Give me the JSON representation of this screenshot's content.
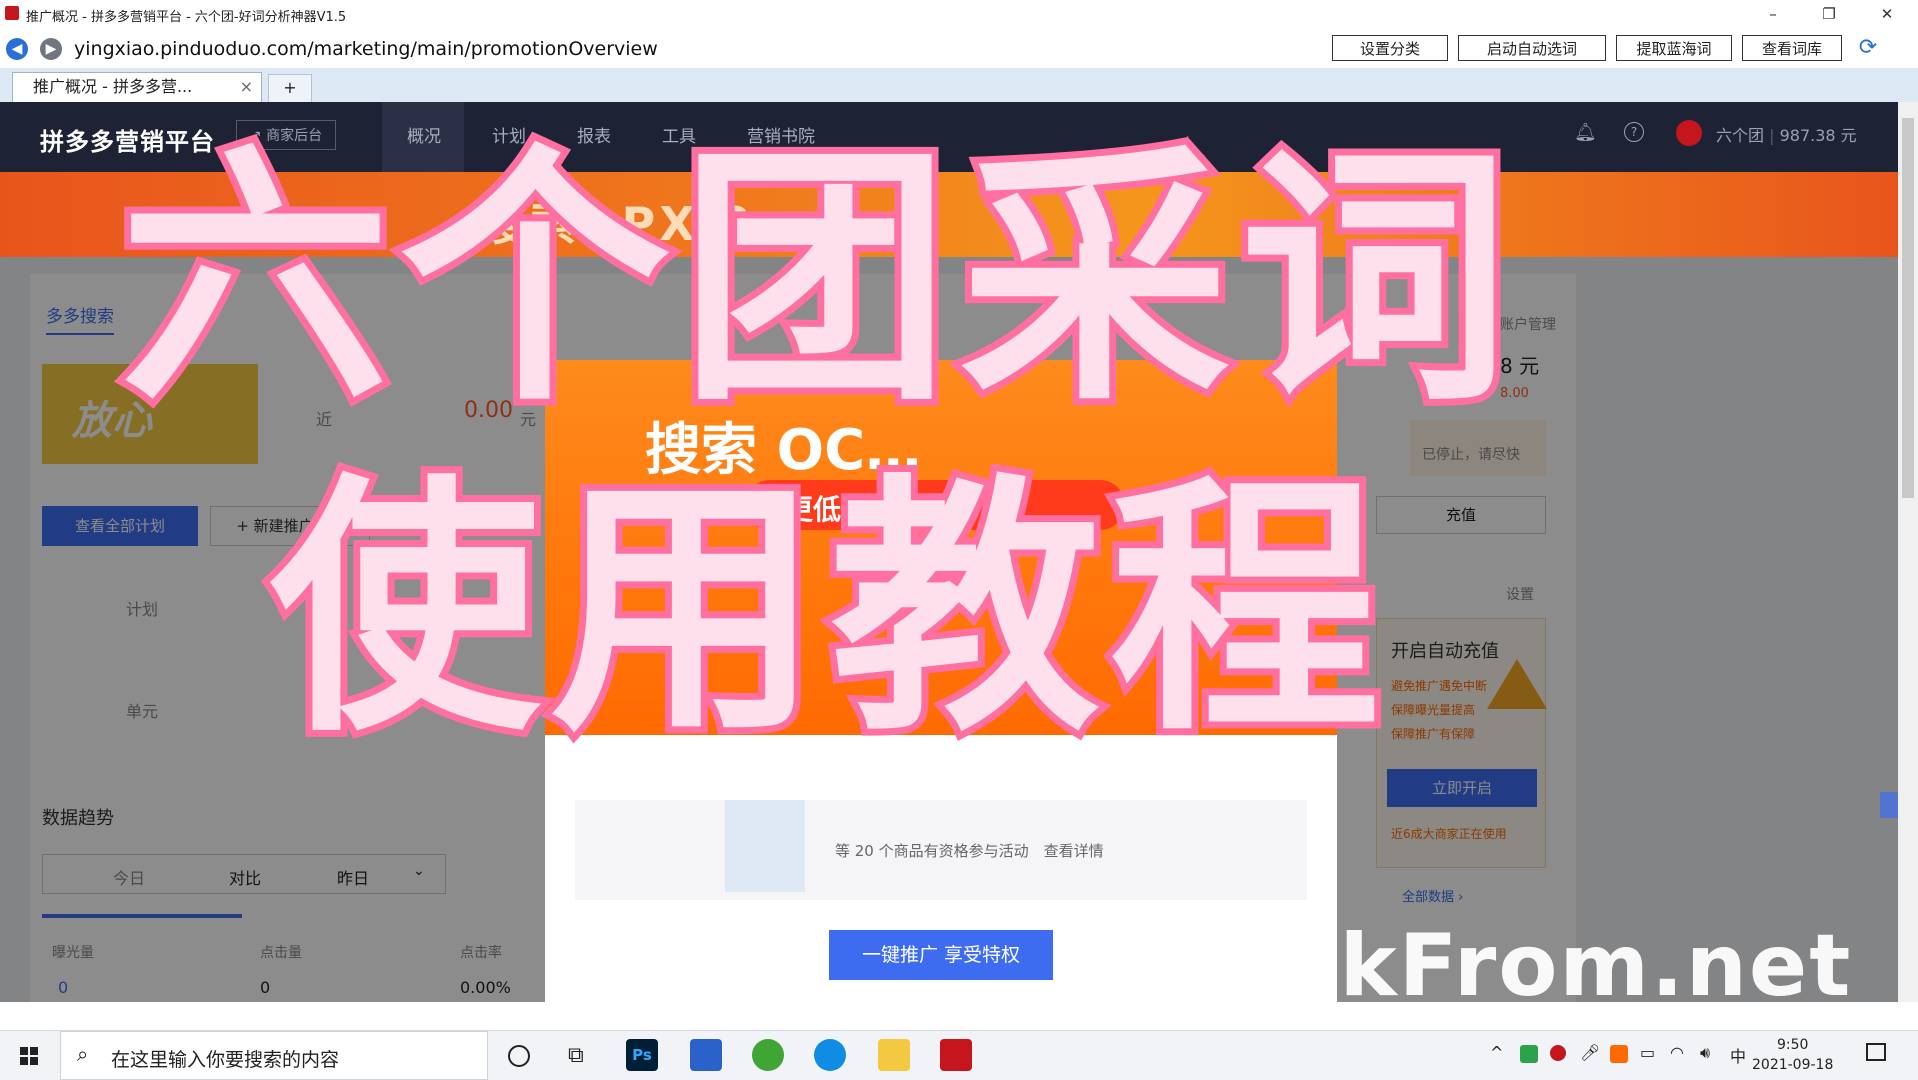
{
  "window": {
    "title": "推广概况 - 拼多多营销平台 - 六个团-好词分析神器V1.5",
    "controls": {
      "minimize": "–",
      "restore": "❐",
      "close": "✕"
    }
  },
  "address_bar": {
    "url": "yingxiao.pinduoduo.com/marketing/main/promotionOverview"
  },
  "toolbar_buttons": [
    "设置分类",
    "启动自动选词",
    "提取蓝海词",
    "查看词库"
  ],
  "tabs": {
    "active_label": "推广概况 - 拼多多营...",
    "close_glyph": "×",
    "new_tab": "+"
  },
  "site": {
    "logo": "拼多多营销平台",
    "merchant_button": "↗ 商家后台",
    "nav": [
      "概况",
      "计划",
      "报表",
      "工具",
      "营销书院"
    ],
    "user_name": "六个团",
    "balance": "987.38 元"
  },
  "banner": {
    "text": "搜索 ·PX 3…"
  },
  "content": {
    "tab_active": "多多搜索",
    "fangxin": "放心",
    "recent_cost_prefix": "近",
    "recent_cost_value": "0.00",
    "recent_cost_unit": "元",
    "view_all_plans": "查看全部计划",
    "new_plan": "+ 新建推广计划",
    "left_items": [
      "计划",
      "单元"
    ],
    "trend_title": "数据趋势",
    "compare_labels": [
      "今日",
      "对比",
      "昨日"
    ],
    "metrics_headers": [
      "曝光量",
      "点击量",
      "点击率"
    ],
    "metrics_values": [
      "0",
      "0",
      "0.00%"
    ],
    "right_panel": {
      "account_manage": "账户管理",
      "amount_suffix": "8 元",
      "sub_amount": "8.00",
      "stopped_notice": "已停止，请尽快",
      "recharge": "充值",
      "settings": "设置",
      "auto_recharge_title": "开启自动充值",
      "benefits": [
        "避免推广遇免中断",
        "保障曝光量提高",
        "保障推广有保障"
      ],
      "enable_btn": "立即开启",
      "footnote": "近6成大商家正在使用",
      "all_data": "全部数据 ›"
    }
  },
  "modal": {
    "title": "搜索 OC…",
    "subtitle": "更低价格 投放",
    "product_text": "等 20 个商品有资格参与活动　查看详情",
    "cta": "一键推广 享受特权"
  },
  "overlay": {
    "line1": "六个团采词",
    "line2": "使用教程",
    "watermark": "PickFrom.net"
  },
  "taskbar": {
    "search_placeholder": "在这里输入你要搜索的内容",
    "time": "9:50",
    "date": "2021-09-18",
    "ime": "中"
  }
}
